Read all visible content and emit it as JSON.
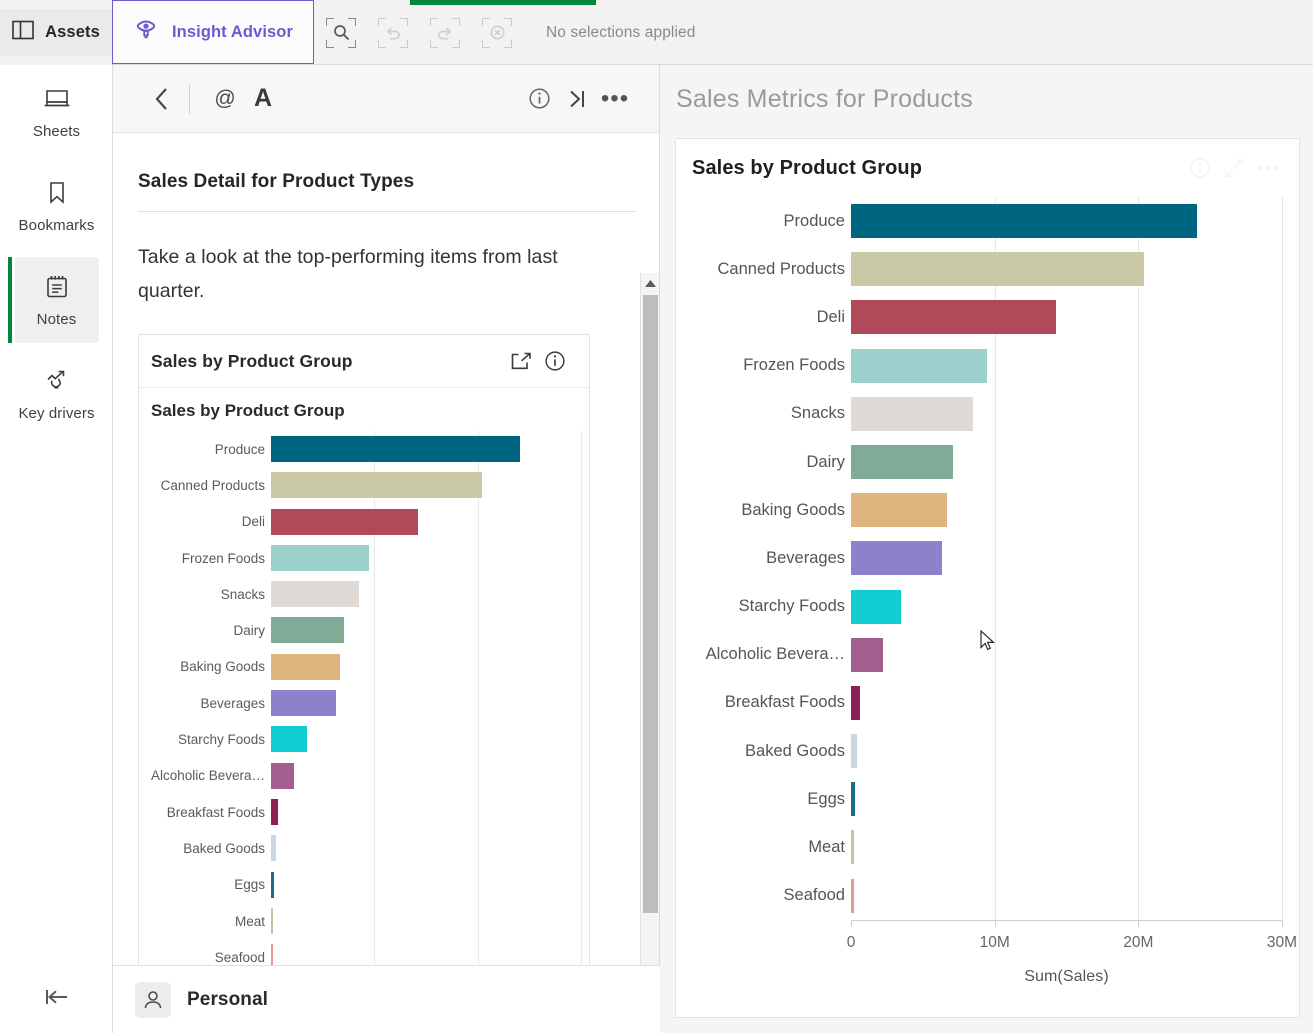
{
  "topbar": {
    "assets_label": "Assets",
    "assets_icon": "panel-icon",
    "insight_advisor_label": "Insight Advisor",
    "insight_advisor_icon": "lightbulb-eye-icon",
    "accent_color": "#6a5bd1",
    "green_accent_color": "#00873d",
    "tools": [
      {
        "name": "selection-search",
        "icon": "magnifier-icon",
        "disabled": false
      },
      {
        "name": "step-back",
        "icon": "undo-arrow-icon",
        "disabled": true
      },
      {
        "name": "step-forward",
        "icon": "redo-arrow-icon",
        "disabled": true
      },
      {
        "name": "clear-selections",
        "icon": "clear-circle-icon",
        "disabled": true
      }
    ],
    "selection_status": "No selections applied"
  },
  "rail": {
    "items": [
      {
        "label": "Sheets",
        "icon": "sheets-icon",
        "active": false
      },
      {
        "label": "Bookmarks",
        "icon": "bookmark-icon",
        "active": false
      },
      {
        "label": "Notes",
        "icon": "notes-icon",
        "active": true
      },
      {
        "label": "Key drivers",
        "icon": "key-drivers-icon",
        "active": false
      }
    ],
    "collapse_icon": "collapse-left-icon",
    "active_marker_color": "#00873d"
  },
  "notes_panel": {
    "toolbar": [
      {
        "name": "back",
        "icon": "chevron-left-icon"
      },
      {
        "name": "mention",
        "icon": "at-sign-icon",
        "glyph": "@"
      },
      {
        "name": "text-format",
        "icon": "font-size-icon",
        "glyph": "A"
      },
      {
        "name": "info",
        "icon": "info-circle-icon"
      },
      {
        "name": "collapse-panel",
        "icon": "collapse-right-icon"
      },
      {
        "name": "more",
        "icon": "more-horizontal-icon"
      }
    ],
    "note_title": "Sales Detail for Product Types",
    "note_body": "Take a look at the top-performing items from last quarter.",
    "embed": {
      "header_title": "Sales by Product Group",
      "header_icons": [
        {
          "name": "open-external",
          "icon": "external-link-icon"
        },
        {
          "name": "info",
          "icon": "info-circle-icon"
        }
      ],
      "chart_title": "Sales by Product Group"
    },
    "scrollbar": {
      "up_icon": "triangle-up-icon",
      "down_icon": "triangle-down-icon"
    }
  },
  "footer": {
    "avatar_icon": "user-icon",
    "space_name": "Personal"
  },
  "main_panel": {
    "title": "Sales Metrics for Products",
    "card": {
      "title": "Sales by Product Group",
      "icons": [
        {
          "name": "info",
          "icon": "info-circle-icon"
        },
        {
          "name": "fullscreen",
          "icon": "expand-diagonal-icon"
        },
        {
          "name": "more",
          "icon": "more-horizontal-icon"
        }
      ]
    }
  },
  "chart_data": {
    "type": "bar",
    "orientation": "horizontal",
    "title": "Sales by Product Group",
    "xlabel": "Sum(Sales)",
    "ylabel": "",
    "xlim": [
      0,
      30000000
    ],
    "xticks": [
      0,
      10000000,
      20000000,
      30000000
    ],
    "xticklabels": [
      "0",
      "10M",
      "20M",
      "30M"
    ],
    "grid": true,
    "legend": "none",
    "categories": [
      "Produce",
      "Canned Products",
      "Deli",
      "Frozen Foods",
      "Snacks",
      "Dairy",
      "Baking Goods",
      "Beverages",
      "Starchy Foods",
      "Alcoholic Beverages",
      "Breakfast Foods",
      "Baked Goods",
      "Eggs",
      "Meat",
      "Seafood"
    ],
    "category_display": [
      "Produce",
      "Canned Products",
      "Deli",
      "Frozen Foods",
      "Snacks",
      "Dairy",
      "Baking Goods",
      "Beverages",
      "Starchy Foods",
      "Alcoholic Bevera…",
      "Breakfast Foods",
      "Baked Goods",
      "Eggs",
      "Meat",
      "Seafood"
    ],
    "values": [
      24100000,
      20400000,
      14250000,
      9450000,
      8500000,
      7100000,
      6700000,
      6300000,
      3500000,
      2250000,
      650000,
      450000,
      250000,
      70000,
      60000
    ],
    "colors": [
      "#006580",
      "#c9c9a6",
      "#b1495a",
      "#9bd0cd",
      "#e0dad6",
      "#7fab97",
      "#e0b47e",
      "#8b82cb",
      "#11cdd2",
      "#a3608f",
      "#8e1f55",
      "#ccd6e0",
      "#1d6e84",
      "#c8c2a8",
      "#e59a95"
    ]
  }
}
